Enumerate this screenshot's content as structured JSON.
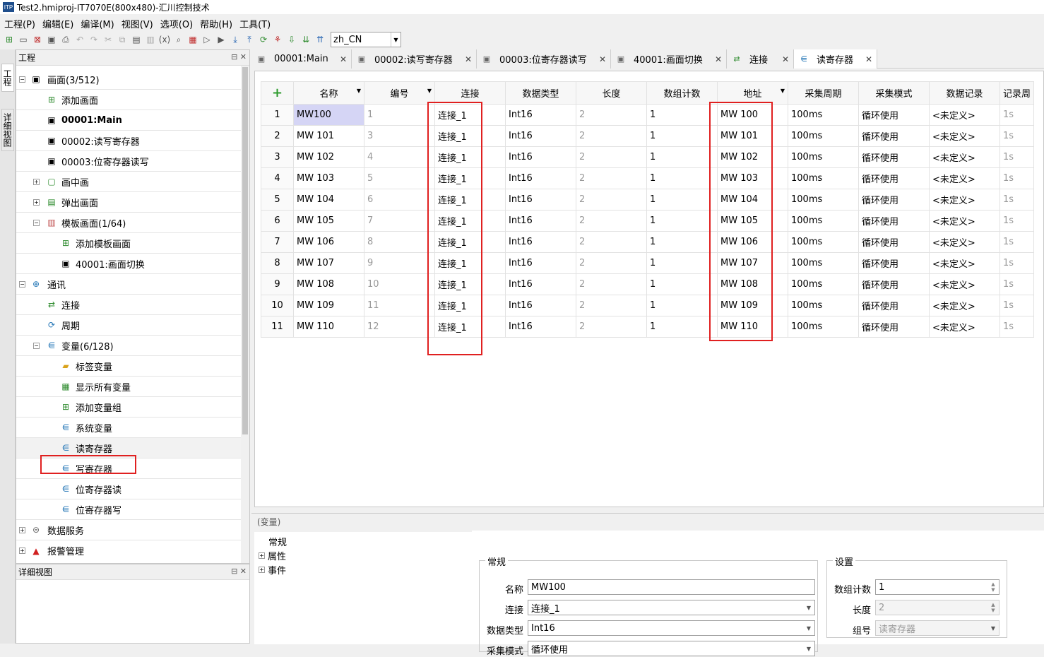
{
  "window": {
    "title": "Test2.hmiproj-IT7070E(800x480)-汇川控制技术",
    "icon_text": "ITP"
  },
  "menu": [
    "工程(P)",
    "编辑(E)",
    "编译(M)",
    "视图(V)",
    "选项(O)",
    "帮助(H)",
    "工具(T)"
  ],
  "toolbar": {
    "language": "zh_CN"
  },
  "sidetabs": {
    "project": "工程",
    "detail": "详细视图"
  },
  "project_panel": {
    "title": "工程",
    "tree": {
      "screens": "画面(3/512)",
      "add_screen": "添加画面",
      "main": "00001:Main",
      "rw_register": "00002:读写寄存器",
      "bit_register": "00003:位寄存器读写",
      "pip": "画中画",
      "popup": "弹出画面",
      "template": "模板画面(1/64)",
      "add_template": "添加模板画面",
      "switch": "40001:画面切换",
      "comm": "通讯",
      "connection": "连接",
      "cycle": "周期",
      "variables": "变量(6/128)",
      "tag_var": "标签变量",
      "show_all": "显示所有变量",
      "add_group": "添加变量组",
      "system_var": "系统变量",
      "read_reg": "读寄存器",
      "write_reg": "写寄存器",
      "bit_read": "位寄存器读",
      "bit_write": "位寄存器写",
      "data_service": "数据服务",
      "alarm": "报警管理"
    }
  },
  "detail_panel": {
    "title": "详细视图"
  },
  "tabs": [
    "00001:Main",
    "00002:读写寄存器",
    "00003:位寄存器读写",
    "40001:画面切换",
    "连接",
    "读寄存器"
  ],
  "grid": {
    "add_symbol": "+",
    "headers": [
      "名称",
      "编号",
      "连接",
      "数据类型",
      "长度",
      "数组计数",
      "地址",
      "采集周期",
      "采集模式",
      "数据记录",
      "记录周"
    ],
    "rows": [
      [
        "1",
        "MW100",
        "1",
        "连接_1",
        "Int16",
        "2",
        "1",
        "MW 100",
        "100ms",
        "循环使用",
        "<未定义>",
        "1s"
      ],
      [
        "2",
        "MW 101",
        "3",
        "连接_1",
        "Int16",
        "2",
        "1",
        "MW 101",
        "100ms",
        "循环使用",
        "<未定义>",
        "1s"
      ],
      [
        "3",
        "MW 102",
        "4",
        "连接_1",
        "Int16",
        "2",
        "1",
        "MW 102",
        "100ms",
        "循环使用",
        "<未定义>",
        "1s"
      ],
      [
        "4",
        "MW 103",
        "5",
        "连接_1",
        "Int16",
        "2",
        "1",
        "MW 103",
        "100ms",
        "循环使用",
        "<未定义>",
        "1s"
      ],
      [
        "5",
        "MW 104",
        "6",
        "连接_1",
        "Int16",
        "2",
        "1",
        "MW 104",
        "100ms",
        "循环使用",
        "<未定义>",
        "1s"
      ],
      [
        "6",
        "MW 105",
        "7",
        "连接_1",
        "Int16",
        "2",
        "1",
        "MW 105",
        "100ms",
        "循环使用",
        "<未定义>",
        "1s"
      ],
      [
        "7",
        "MW 106",
        "8",
        "连接_1",
        "Int16",
        "2",
        "1",
        "MW 106",
        "100ms",
        "循环使用",
        "<未定义>",
        "1s"
      ],
      [
        "8",
        "MW 107",
        "9",
        "连接_1",
        "Int16",
        "2",
        "1",
        "MW 107",
        "100ms",
        "循环使用",
        "<未定义>",
        "1s"
      ],
      [
        "9",
        "MW 108",
        "10",
        "连接_1",
        "Int16",
        "2",
        "1",
        "MW 108",
        "100ms",
        "循环使用",
        "<未定义>",
        "1s"
      ],
      [
        "10",
        "MW 109",
        "11",
        "连接_1",
        "Int16",
        "2",
        "1",
        "MW 109",
        "100ms",
        "循环使用",
        "<未定义>",
        "1s"
      ],
      [
        "11",
        "MW 110",
        "12",
        "连接_1",
        "Int16",
        "2",
        "1",
        "MW 110",
        "100ms",
        "循环使用",
        "<未定义>",
        "1s"
      ]
    ]
  },
  "properties": {
    "header": "(变量)",
    "nav": [
      "常规",
      "属性",
      "事件"
    ],
    "general": {
      "title": "常规",
      "name_label": "名称",
      "name": "MW100",
      "conn_label": "连接",
      "conn": "连接_1",
      "type_label": "数据类型",
      "type": "Int16",
      "mode_label": "采集模式",
      "mode": "循环使用"
    },
    "settings": {
      "title": "设置",
      "count_label": "数组计数",
      "count": "1",
      "len_label": "长度",
      "len": "2",
      "group_label": "组号",
      "group": "读寄存器"
    }
  }
}
